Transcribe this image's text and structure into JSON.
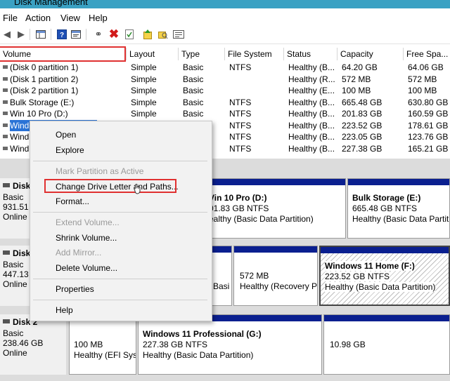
{
  "window": {
    "title": "Disk Management",
    "titlebar_color": "#3aa1c3"
  },
  "menu": [
    "File",
    "Action",
    "View",
    "Help"
  ],
  "toolbar": {
    "icons": [
      "back-arrow-icon",
      "forward-arrow-icon",
      "console-tree-icon",
      "help-icon",
      "properties-icon",
      "connect-icon",
      "delete-icon",
      "check-icon",
      "folder-up-icon",
      "search-folder-icon",
      "details-view-icon"
    ]
  },
  "columns": [
    "Volume",
    "Layout",
    "Type",
    "File System",
    "Status",
    "Capacity",
    "Free Spa..."
  ],
  "volumes": [
    {
      "volume": "(Disk 0 partition 1)",
      "layout": "Simple",
      "type": "Basic",
      "fs": "NTFS",
      "status": "Healthy (B...",
      "capacity": "64.20 GB",
      "free": "64.06 GB"
    },
    {
      "volume": "(Disk 1 partition 2)",
      "layout": "Simple",
      "type": "Basic",
      "fs": "",
      "status": "Healthy (R...",
      "capacity": "572 MB",
      "free": "572 MB"
    },
    {
      "volume": "(Disk 2 partition 1)",
      "layout": "Simple",
      "type": "Basic",
      "fs": "",
      "status": "Healthy (E...",
      "capacity": "100 MB",
      "free": "100 MB"
    },
    {
      "volume": "Bulk Storage (E:)",
      "layout": "Simple",
      "type": "Basic",
      "fs": "NTFS",
      "status": "Healthy (B...",
      "capacity": "665.48 GB",
      "free": "630.80 GB"
    },
    {
      "volume": "Win 10 Pro (D:)",
      "layout": "Simple",
      "type": "Basic",
      "fs": "NTFS",
      "status": "Healthy (B...",
      "capacity": "201.83 GB",
      "free": "160.59 GB"
    },
    {
      "volume": "Windows 11 Home (F:)",
      "layout": "Simple",
      "type": "Basic",
      "fs": "NTFS",
      "status": "Healthy (B...",
      "capacity": "223.52 GB",
      "free": "178.61 GB"
    },
    {
      "volume": "Wind",
      "layout": "",
      "type": "",
      "fs": "NTFS",
      "status": "Healthy (B...",
      "capacity": "223.05 GB",
      "free": "123.76 GB"
    },
    {
      "volume": "Wind",
      "layout": "",
      "type": "",
      "fs": "NTFS",
      "status": "Healthy (B...",
      "capacity": "227.38 GB",
      "free": "165.21 GB"
    }
  ],
  "disks": [
    {
      "name": "Disk",
      "type": "Basic",
      "size": "931.51 (",
      "state": "Online",
      "partitions": [
        {
          "name": "Vin 10 Pro  (D:)",
          "size": "01.83 GB NTFS",
          "status": "ealthy (Basic Data Partition)"
        },
        {
          "name": "Bulk Storage  (E:)",
          "size": "665.48 GB NTFS",
          "status": "Healthy (Basic Data Partition)"
        }
      ]
    },
    {
      "name": "Disk",
      "type": "Basic",
      "size": "447.13 (",
      "state": "Online",
      "partitions": [
        {
          "name": "",
          "size": "",
          "status": "Basi"
        },
        {
          "name": "",
          "size": "572 MB",
          "status": "Healthy (Recovery Pa"
        },
        {
          "name": "Windows 11 Home  (F:)",
          "size": "223.52 GB NTFS",
          "status": "Healthy (Basic Data Partition)"
        }
      ]
    },
    {
      "name": "Disk 2",
      "type": "Basic",
      "size": "238.46 GB",
      "state": "Online",
      "partitions": [
        {
          "name": "",
          "size": "100 MB",
          "status": "Healthy (EFI Syst"
        },
        {
          "name": "Windows 11 Professional  (G:)",
          "size": "227.38 GB NTFS",
          "status": "Healthy (Basic Data Partition)"
        },
        {
          "name": "",
          "size": "10.98 GB",
          "status": ""
        }
      ]
    }
  ],
  "context_menu": {
    "open": "Open",
    "explore": "Explore",
    "mark_active": "Mark Partition as Active",
    "change_letter": "Change Drive Letter and Paths...",
    "format": "Format...",
    "extend": "Extend Volume...",
    "shrink": "Shrink Volume...",
    "add_mirror": "Add Mirror...",
    "delete": "Delete Volume...",
    "properties": "Properties",
    "help": "Help"
  },
  "colors": {
    "partition_bar": "#0a1f8f",
    "selection": "#2a73d6",
    "highlight_box": "#e03131"
  }
}
